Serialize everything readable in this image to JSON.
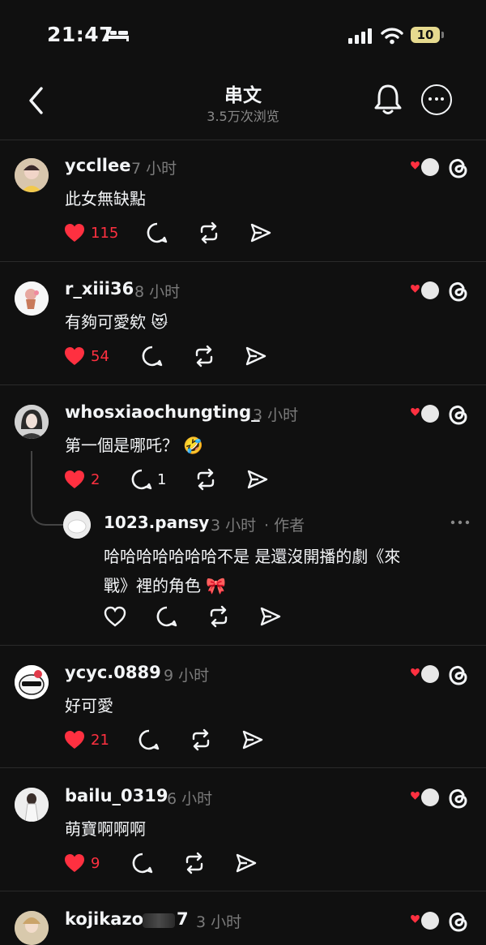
{
  "status_bar": {
    "time": "21:47",
    "battery": "10"
  },
  "header": {
    "title": "串文",
    "views": "3.5万次浏览"
  },
  "comments": [
    {
      "username": "yccllee",
      "time": "7 小时",
      "text": "此女無缺點",
      "likes": "115"
    },
    {
      "username": "r_xiii36",
      "time": "8 小时",
      "text": "有夠可愛欸",
      "emoji": "😻",
      "likes": "54"
    },
    {
      "username": "whosxiaochungting_",
      "time": "3 小时",
      "text": "第一個是哪吒？",
      "emoji": "🤣",
      "likes": "2",
      "replies": "1"
    },
    {
      "username": "ycyc.0889",
      "time": "9 小时",
      "text": "好可愛",
      "likes": "21"
    },
    {
      "username": "bailu_0319",
      "time": "6 小时",
      "text": "萌寶啊啊啊",
      "likes": "9"
    },
    {
      "username": "kojikazo",
      "username_suffix": "7",
      "time": "3 小时"
    }
  ],
  "reply": {
    "username": "1023.pansy",
    "time": "3 小时",
    "author_tag": "· 作者",
    "text_line1": "哈哈哈哈哈哈哈不是 是還沒開播的劇《來",
    "text_line2": "戰》裡的角色",
    "emoji": "🎀"
  },
  "colors": {
    "background": "#101010",
    "like_red": "#ff3040",
    "secondary_text": "#7b7b7b"
  }
}
